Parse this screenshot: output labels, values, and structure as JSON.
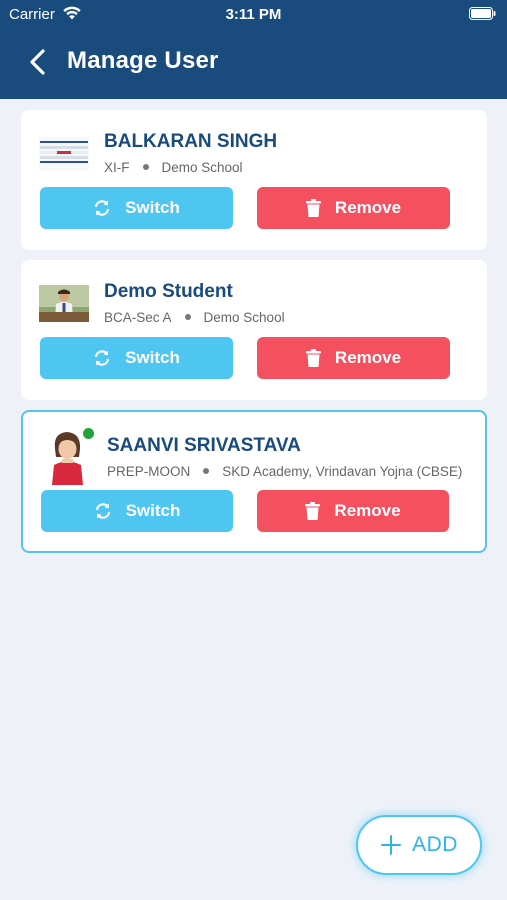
{
  "status_bar": {
    "carrier": "Carrier",
    "time": "3:11 PM"
  },
  "header": {
    "title": "Manage User"
  },
  "users": [
    {
      "name": "BALKARAN SINGH",
      "class": "XI-F",
      "school": "Demo School",
      "switch_label": "Switch",
      "remove_label": "Remove",
      "selected": false,
      "online": false
    },
    {
      "name": "Demo Student",
      "class": "BCA-Sec A",
      "school": "Demo School",
      "switch_label": "Switch",
      "remove_label": "Remove",
      "selected": false,
      "online": false
    },
    {
      "name": "SAANVI SRIVASTAVA",
      "class": "PREP-MOON",
      "school": "SKD Academy, Vrindavan Yojna (CBSE)",
      "switch_label": "Switch",
      "remove_label": "Remove",
      "selected": true,
      "online": true
    }
  ],
  "add_button": {
    "label": "ADD"
  },
  "colors": {
    "header": "#1a4b7d",
    "switch": "#4fc6f2",
    "remove": "#f4505f",
    "online": "#22a43a"
  }
}
